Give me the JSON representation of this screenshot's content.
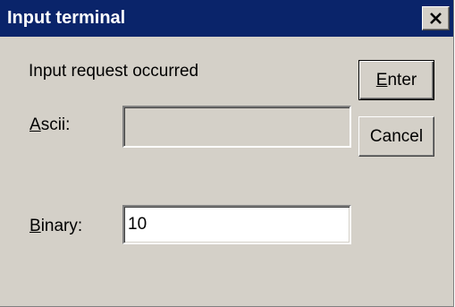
{
  "window": {
    "title": "Input terminal",
    "close_icon": "close-x-icon"
  },
  "message": "Input request occurred",
  "ascii": {
    "label_mnemonic": "A",
    "label_rest": "scii:",
    "value": "",
    "enabled": false
  },
  "binary": {
    "label_mnemonic": "B",
    "label_rest": "inary:",
    "value": "10",
    "enabled": true
  },
  "buttons": {
    "enter_mnemonic": "E",
    "enter_rest": "nter",
    "cancel_label": "Cancel"
  },
  "colors": {
    "titlebar": "#0a246a",
    "face": "#d4d0c8"
  }
}
